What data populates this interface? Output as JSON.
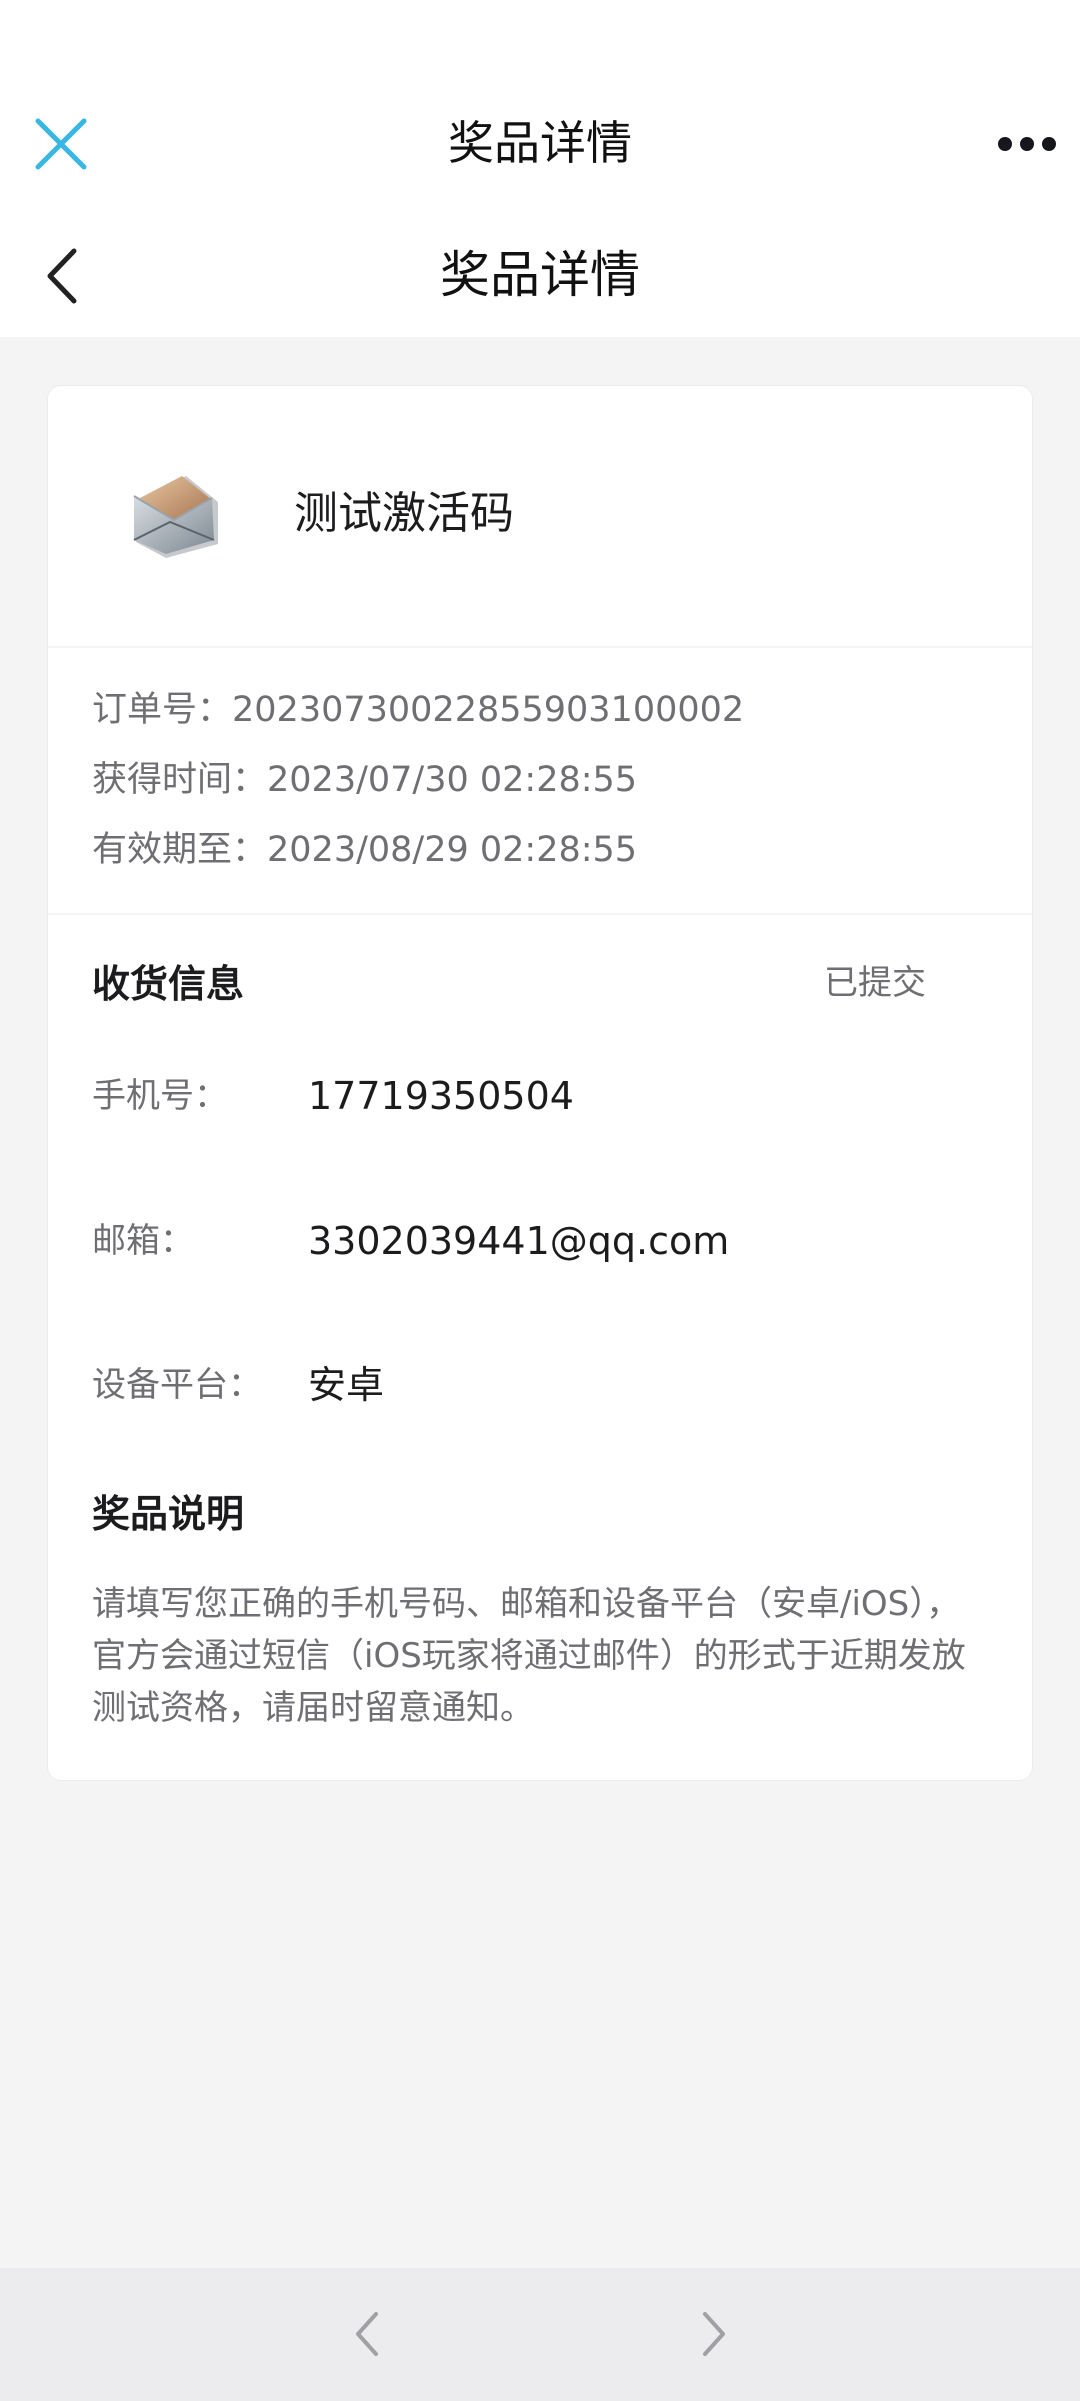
{
  "header": {
    "title": "奖品详情",
    "close_icon": "close-icon",
    "more_icon": "more-dots-icon",
    "accent_color": "#38b6e6"
  },
  "page": {
    "title": "奖品详情",
    "back_icon": "chevron-left-icon"
  },
  "prize": {
    "name": "测试激活码",
    "icon": "envelope-icon"
  },
  "order": {
    "order_label": "订单号：",
    "order_value": "20230730022855903100002",
    "obtained_label": "获得时间：",
    "obtained_value": "2023/07/30 02:28:55",
    "valid_label": "有效期至：",
    "valid_value": "2023/08/29 02:28:55"
  },
  "shipping": {
    "title": "收货信息",
    "status": "已提交",
    "fields": [
      {
        "label": "手机号：",
        "value": "17719350504"
      },
      {
        "label": "邮箱：",
        "value": "3302039441@qq.com"
      },
      {
        "label": "设备平台：",
        "value": "安卓"
      }
    ]
  },
  "description": {
    "title": "奖品说明",
    "text": "请填写您正确的手机号码、邮箱和设备平台（安卓/iOS），官方会通过短信（iOS玩家将通过邮件）的形式于近期发放测试资格，请届时留意通知。"
  },
  "bottom_nav": {
    "prev_icon": "chevron-left-icon",
    "next_icon": "chevron-right-icon"
  }
}
